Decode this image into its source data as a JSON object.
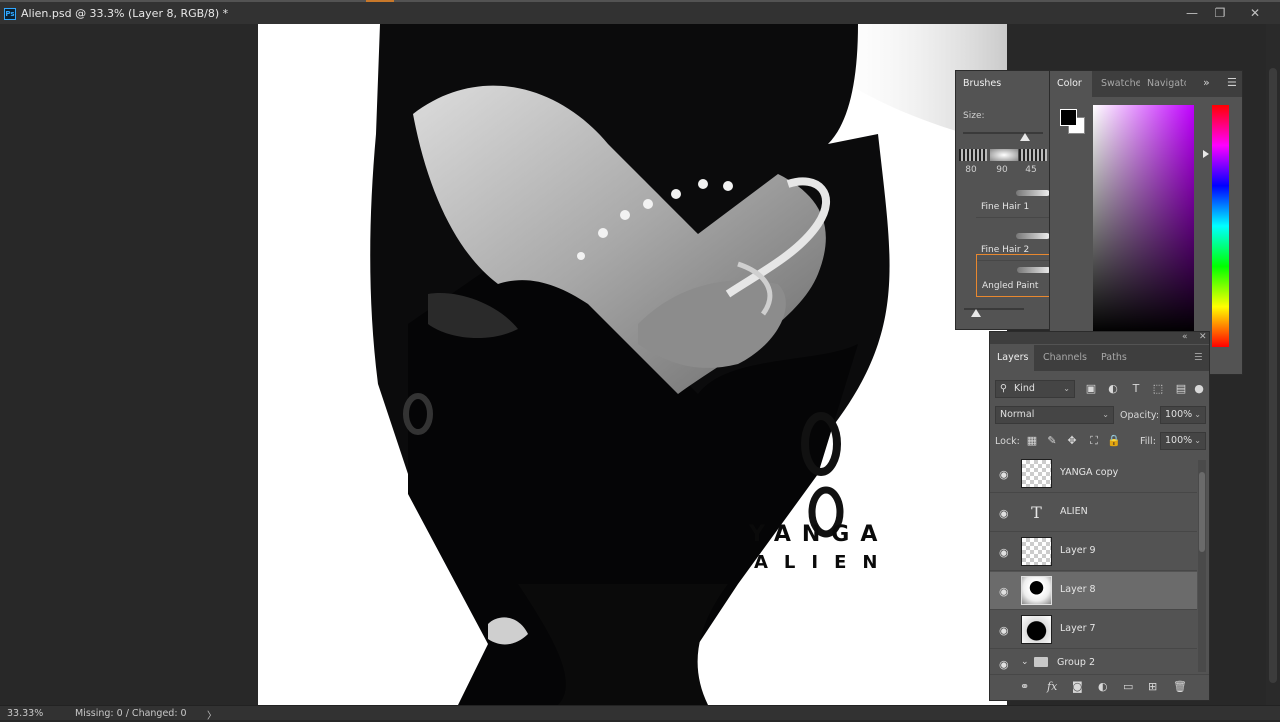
{
  "window": {
    "title": "Alien.psd @ 33.3% (Layer 8, RGB/8) *",
    "app_icon": "Ps",
    "controls": {
      "minimize": "—",
      "restore": "❐",
      "close": "✕"
    }
  },
  "canvas": {
    "poster_line1": "YANGA",
    "poster_line2": "ALIEN"
  },
  "brushes_panel": {
    "tab": "Brushes",
    "size_label": "Size:",
    "tip_sizes": [
      "80",
      "90",
      "45"
    ],
    "items": [
      {
        "label": "Fine Hair 1",
        "selected": false
      },
      {
        "label": "Fine Hair 2",
        "selected": false
      },
      {
        "label": "Angled Paint",
        "selected": true
      }
    ]
  },
  "color_panel": {
    "tabs": [
      "Color",
      "Swatches",
      "Navigator"
    ],
    "active_tab": "Color",
    "foreground": "#000000",
    "background": "#ffffff",
    "expand_icon": "»",
    "menu_icon": "☰"
  },
  "layers_panel": {
    "tabs": [
      "Layers",
      "Channels",
      "Paths"
    ],
    "active_tab": "Layers",
    "top_controls": {
      "collapse": "«",
      "close": "✕"
    },
    "filter_kind": "Kind",
    "blend_mode": "Normal",
    "opacity_label": "Opacity:",
    "opacity_value": "100%",
    "lock_label": "Lock:",
    "fill_label": "Fill:",
    "fill_value": "100%",
    "layers": [
      {
        "name": "YANGA copy",
        "type": "pixel",
        "selected": false
      },
      {
        "name": "ALIEN",
        "type": "text",
        "selected": false
      },
      {
        "name": "Layer 9",
        "type": "pixel",
        "selected": false
      },
      {
        "name": "Layer 8",
        "type": "art",
        "selected": true
      },
      {
        "name": "Layer 7",
        "type": "art2",
        "selected": false
      },
      {
        "name": "Group 2",
        "type": "group",
        "selected": false
      }
    ],
    "text_thumb_glyph": "T",
    "eye_glyph": "👁"
  },
  "statusbar": {
    "zoom": "33.33%",
    "info": "Missing: 0 / Changed: 0",
    "arrow": "〉"
  }
}
